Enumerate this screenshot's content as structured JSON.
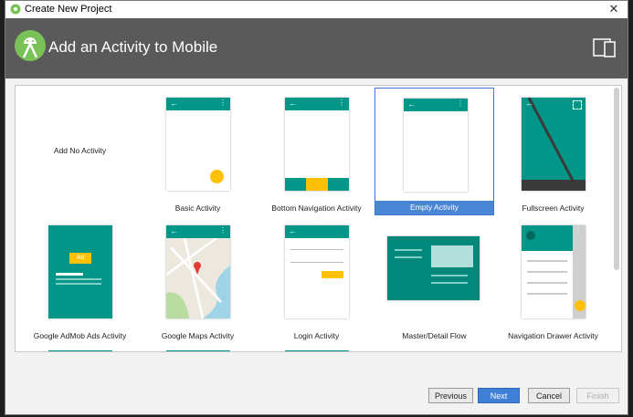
{
  "window": {
    "title": "Create New Project",
    "close_glyph": "✕"
  },
  "header": {
    "title": "Add an Activity to Mobile"
  },
  "templates": [
    {
      "label": "Add No Activity"
    },
    {
      "label": "Basic Activity"
    },
    {
      "label": "Bottom Navigation Activity"
    },
    {
      "label": "Empty Activity",
      "selected": true
    },
    {
      "label": "Fullscreen Activity"
    },
    {
      "label": "Google AdMob Ads Activity",
      "ad_text": "Ad"
    },
    {
      "label": "Google Maps Activity"
    },
    {
      "label": "Login Activity"
    },
    {
      "label": "Master/Detail Flow"
    },
    {
      "label": "Navigation Drawer Activity"
    }
  ],
  "buttons": {
    "previous": "Previous",
    "next": "Next",
    "cancel": "Cancel",
    "finish": "Finish"
  },
  "colors": {
    "accent": "#009688",
    "fab": "#FFC107",
    "selection": "#4a86d6",
    "header": "#5a5a5a"
  },
  "icons": {
    "back": "←",
    "overflow": "⋮"
  }
}
